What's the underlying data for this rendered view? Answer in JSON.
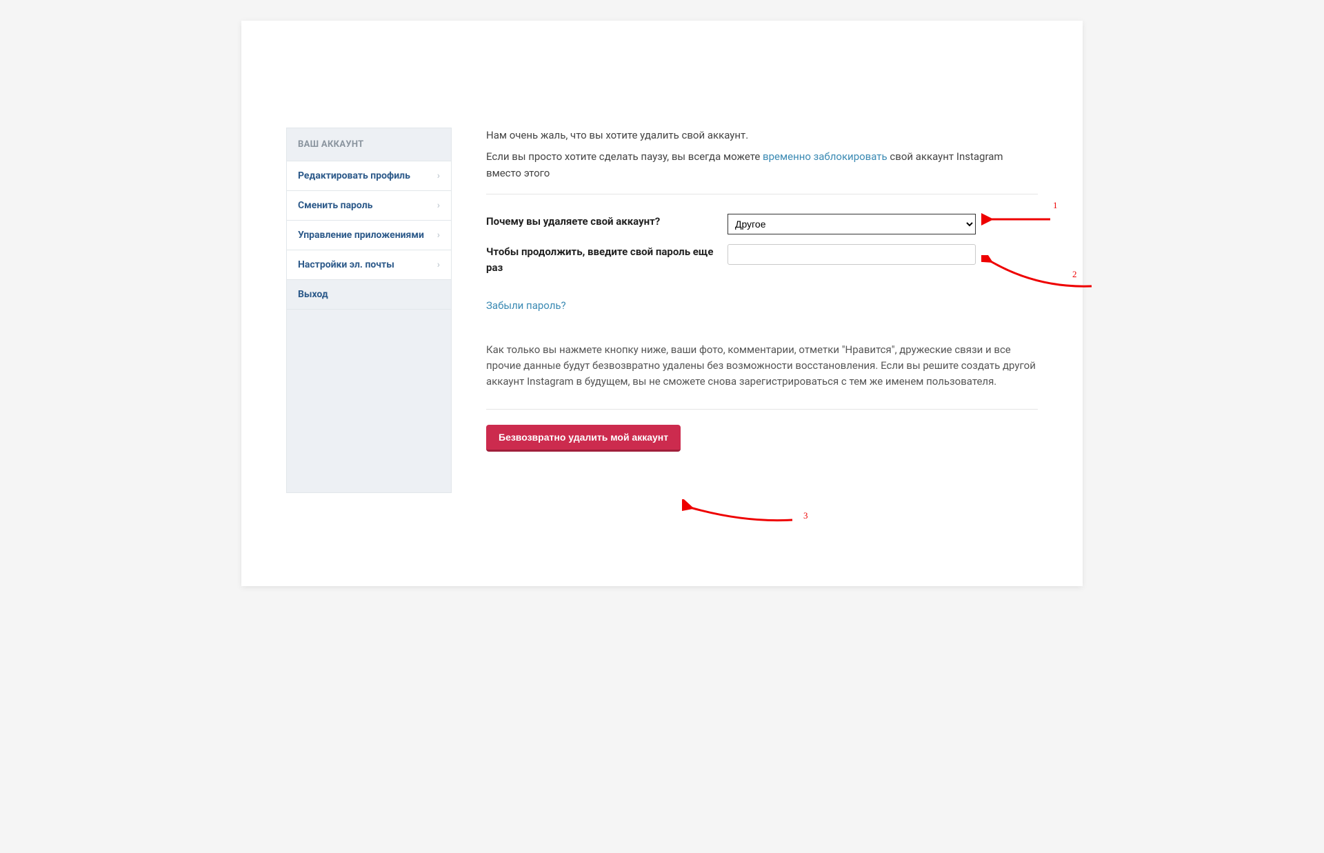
{
  "sidebar": {
    "header": "ВАШ АККАУНТ",
    "items": [
      {
        "label": "Редактировать профиль",
        "chevron": true
      },
      {
        "label": "Сменить пароль",
        "chevron": true
      },
      {
        "label": "Управление приложениями",
        "chevron": true
      },
      {
        "label": "Настройки эл. почты",
        "chevron": true
      },
      {
        "label": "Выход",
        "chevron": false
      }
    ]
  },
  "main": {
    "sorry_text": "Нам очень жаль, что вы хотите удалить свой аккаунт.",
    "pause_prefix": "Если вы просто хотите сделать паузу, вы всегда можете ",
    "pause_link": "временно заблокировать",
    "pause_suffix": " свой аккаунт Instagram вместо этого",
    "reason_label": "Почему вы удаляете свой аккаунт?",
    "reason_selected": "Другое",
    "password_label": "Чтобы продолжить, введите свой пароль еще раз",
    "forgot_link": "Забыли пароль?",
    "warning_text": "Как только вы нажмете кнопку ниже, ваши фото, комментарии, отметки \"Нравится\", дружеские связи и все прочие данные будут безвозвратно удалены без возможности восстановления. Если вы решите создать другой аккаунт Instagram в будущем, вы не сможете снова зарегистрироваться с тем же именем пользователя.",
    "delete_button": "Безвозвратно удалить мой аккаунт"
  },
  "annotations": {
    "a1": "1",
    "a2": "2",
    "a3": "3"
  }
}
